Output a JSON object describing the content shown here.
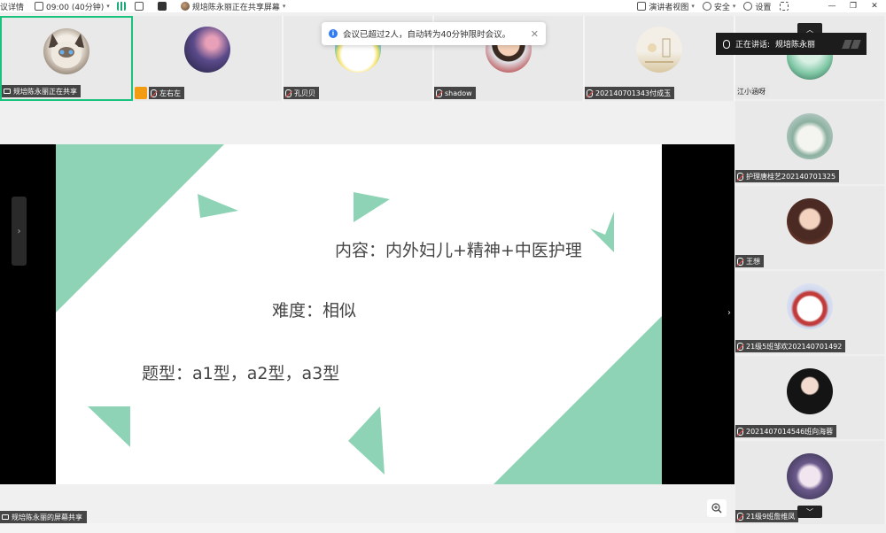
{
  "toolbar": {
    "meeting_details": "议详情",
    "timer": "09:00 (40分钟)",
    "sharer": "规培陈永丽正在共享屏幕",
    "presenter_view": "演讲者视图",
    "security": "安全",
    "settings": "设置"
  },
  "toast": {
    "message": "会议已超过2人，自动转为40分钟限时会议。"
  },
  "speaking": {
    "label": "正在讲话:",
    "name": "规培陈永丽"
  },
  "top_participants": [
    {
      "name": "规培陈永丽正在共享",
      "avatar": "cat"
    },
    {
      "name": "左右左",
      "avatar": "purple"
    },
    {
      "name": "孔贝贝",
      "avatar": "cartoon"
    },
    {
      "name": "shadow",
      "avatar": "boy"
    },
    {
      "name": "202140701343付成玉",
      "avatar": "sketch"
    }
  ],
  "right_participants": [
    {
      "name": "江小涵呀"
    },
    {
      "name": "护理唐桂艺202140701325"
    },
    {
      "name": "王想"
    },
    {
      "name": "21级5班邹欢202140701492"
    },
    {
      "name": "202140701454​6班向海蓉"
    },
    {
      "name": "21级9班詹维凤"
    }
  ],
  "slide": {
    "line1": "内容：内外妇儿+精神+中医护理",
    "line2": "难度：相似",
    "line3": "题型：a1型，a2型，a3型",
    "accent_color": "#8fd3b6"
  },
  "share_tag": "规培陈永丽的屏幕共享",
  "icons": {
    "zoom": "zoom-in-icon",
    "mic_muted": "mic-muted-icon"
  }
}
